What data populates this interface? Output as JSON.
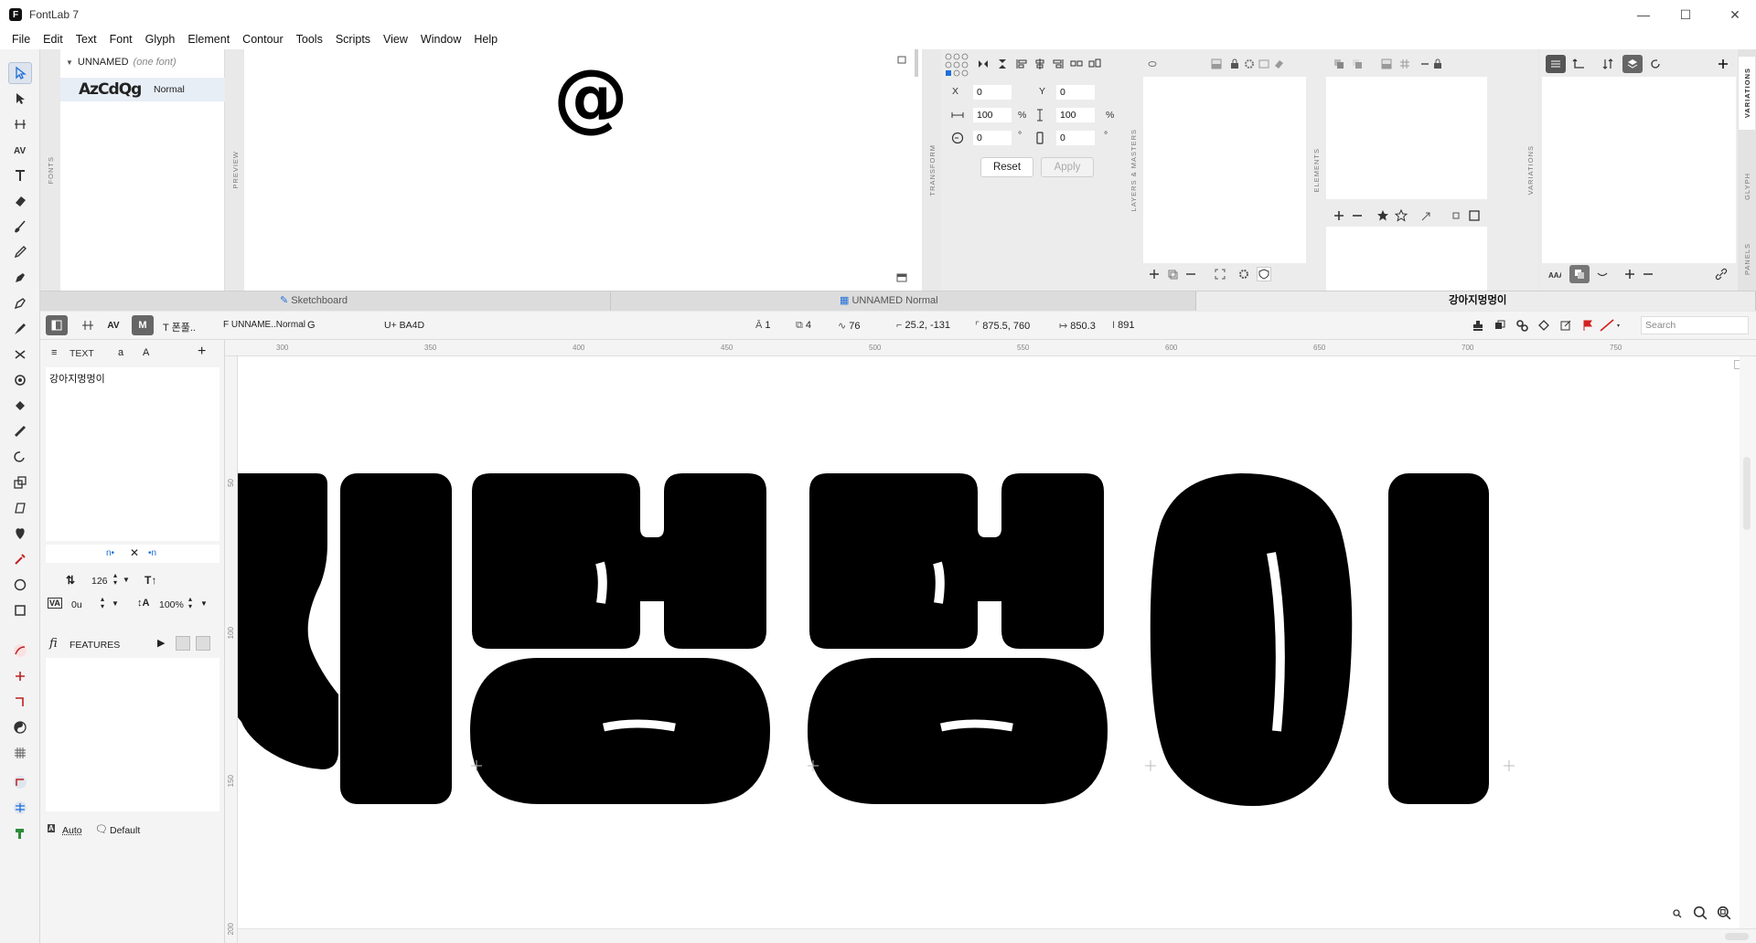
{
  "app": {
    "title": "FontLab 7"
  },
  "menu": [
    "File",
    "Edit",
    "Text",
    "Font",
    "Glyph",
    "Element",
    "Contour",
    "Tools",
    "Scripts",
    "View",
    "Window",
    "Help"
  ],
  "fonts_panel": {
    "label": "FONTS",
    "font_name": "UNNAMED",
    "font_note": "(one font)",
    "sample": "AzCdQg",
    "style": "Normal"
  },
  "preview_panel": {
    "label": "PREVIEW",
    "glyph": "@"
  },
  "transform_panel": {
    "label": "TRANSFORM",
    "x_label": "X",
    "x_value": "0",
    "y_label": "Y",
    "y_value": "0",
    "width_value": "100",
    "width_unit": "%",
    "height_value": "100",
    "height_unit": "%",
    "rotate_value": "0",
    "rotate_unit": "°",
    "slant_value": "0",
    "slant_unit": "°",
    "reset_label": "Reset",
    "apply_label": "Apply"
  },
  "layers_panel": {
    "label": "LAYERS & MASTERS"
  },
  "elements_panel": {
    "label": "ELEMENTS"
  },
  "variations_panel": {
    "label": "VARIATIONS"
  },
  "side_tabs": [
    "VARIATIONS",
    "GLYPH",
    "PANELS"
  ],
  "tabs": [
    {
      "label": "Sketchboard",
      "icon": "pen-icon"
    },
    {
      "label": "UNNAMED Normal",
      "icon": "grid-icon"
    },
    {
      "label": "강아지멍멍이"
    }
  ],
  "glyph_toolbar": {
    "mode_label": "M",
    "text_field": "T 폰풀..",
    "font_field": "F UNNAME..Normal",
    "glyph_field": "G",
    "unicode_field": "U+ BA4D",
    "layers_count": "1",
    "contours_count": "4",
    "nodes_count": "76",
    "coords": "25.2, -131",
    "dimensions": "875.5, 760",
    "advance_width": "850.3",
    "height_value": "891",
    "search_placeholder": "Search"
  },
  "text_panel": {
    "header": "TEXT",
    "case_lower": "a",
    "case_upper": "A",
    "text_content": "강아지멍멍이",
    "prefix_marker": "n•",
    "suffix_marker": "•n",
    "font_size": "126",
    "tracking": "0u",
    "line_height": "100%",
    "features_label": "FEATURES",
    "auto_label": "Auto",
    "default_label": "Default"
  },
  "canvas": {
    "ruler_top_ticks": [
      "300",
      "350",
      "400",
      "450",
      "500",
      "550",
      "600",
      "650",
      "700",
      "750"
    ],
    "ruler_left_ticks": [
      "50",
      "100",
      "150",
      "200"
    ]
  },
  "colors": {
    "accent": "#1e6fd9",
    "red": "#d32020",
    "selection": "#dde4ee"
  }
}
